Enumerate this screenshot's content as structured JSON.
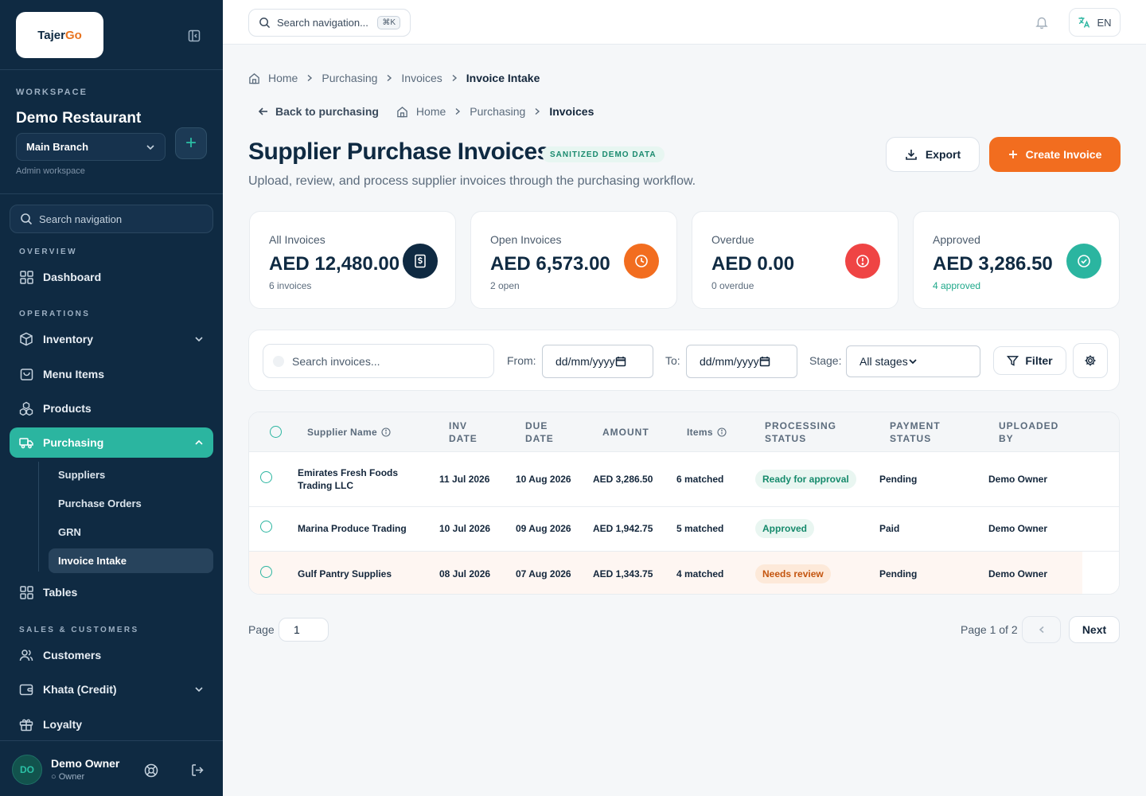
{
  "app": {
    "logo_primary": "Tajer",
    "logo_accent": "Go"
  },
  "sidebar": {
    "workspace_label": "WORKSPACE",
    "workspace_name": "Demo Restaurant",
    "branch": "Main Branch",
    "workspace_sub": "Admin workspace",
    "search_placeholder": "Search navigation",
    "sections": {
      "overview": "OVERVIEW",
      "operations": "OPERATIONS",
      "sales": "SALES & CUSTOMERS"
    },
    "items": {
      "dashboard": "Dashboard",
      "inventory": "Inventory",
      "menu_items": "Menu Items",
      "products": "Products",
      "purchasing": "Purchasing",
      "tables": "Tables",
      "customers": "Customers",
      "khata": "Khata (Credit)",
      "loyalty": "Loyalty"
    },
    "purchasing_sub": {
      "suppliers": "Suppliers",
      "purchase_orders": "Purchase Orders",
      "grn": "GRN",
      "invoice_intake": "Invoice Intake"
    },
    "user": {
      "initials": "DO",
      "name": "Demo Owner",
      "role": "Owner"
    }
  },
  "topbar": {
    "search_placeholder": "Search navigation...",
    "shortcut": "⌘K",
    "language": "EN"
  },
  "breadcrumbs": {
    "home": "Home",
    "purchasing": "Purchasing",
    "invoices": "Invoices",
    "current": "Invoice Intake"
  },
  "subnav": {
    "back": "Back to purchasing",
    "home": "Home",
    "purchasing": "Purchasing",
    "current": "Invoices"
  },
  "page": {
    "title": "Supplier Purchase Invoices",
    "badge": "SANITIZED DEMO DATA",
    "subtitle": "Upload, review, and process supplier invoices through the purchasing workflow.",
    "export_label": "Export",
    "create_label": "Create Invoice"
  },
  "stats": [
    {
      "label": "All Invoices",
      "value": "AED 12,480.00",
      "sub": "6 invoices",
      "icon": "dollar-icon",
      "color": "#0f2a42"
    },
    {
      "label": "Open Invoices",
      "value": "AED 6,573.00",
      "sub": "2 open",
      "icon": "clock-icon",
      "color": "#f26d1f"
    },
    {
      "label": "Overdue",
      "value": "AED 0.00",
      "sub": "0 overdue",
      "icon": "alert-icon",
      "color": "#ef4444"
    },
    {
      "label": "Approved",
      "value": "AED 3,286.50",
      "sub": "4 approved",
      "icon": "check-icon",
      "color": "#2bb5a0"
    }
  ],
  "filters": {
    "search_placeholder": "Search invoices...",
    "from_label": "From:",
    "from_value": "dd/mm/yyyy",
    "to_label": "To:",
    "to_value": "dd/mm/yyyy",
    "stage_label": "Stage:",
    "stage_value": "All stages",
    "filter_label": "Filter"
  },
  "table": {
    "headers": {
      "supplier": "Supplier Name",
      "inv_date": "INV DATE",
      "due_date": "DUE DATE",
      "amount": "AMOUNT",
      "items": "Items",
      "processing": "PROCESSING STATUS",
      "payment": "PAYMENT STATUS",
      "uploaded": "UPLOADED BY"
    },
    "rows": [
      {
        "supplier": "Emirates Fresh Foods Trading LLC",
        "inv_date": "11 Jul 2026",
        "due_date": "10 Aug 2026",
        "amount": "AED 3,286.50",
        "items": "6 matched",
        "processing": "Ready for approval",
        "payment": "Pending",
        "uploaded": "Demo Owner"
      },
      {
        "supplier": "Marina Produce Trading",
        "inv_date": "10 Jul 2026",
        "due_date": "09 Aug 2026",
        "amount": "AED 1,942.75",
        "items": "5 matched",
        "processing": "Approved",
        "payment": "Paid",
        "uploaded": "Demo Owner"
      },
      {
        "supplier": "Gulf Pantry Supplies",
        "inv_date": "08 Jul 2026",
        "due_date": "07 Aug 2026",
        "amount": "AED 1,343.75",
        "items": "4 matched",
        "processing": "Needs review",
        "payment": "Pending",
        "uploaded": "Demo Owner"
      }
    ]
  },
  "pagination": {
    "label": "Page",
    "value": "1",
    "info": "Page 1 of 2",
    "next": "Next"
  }
}
